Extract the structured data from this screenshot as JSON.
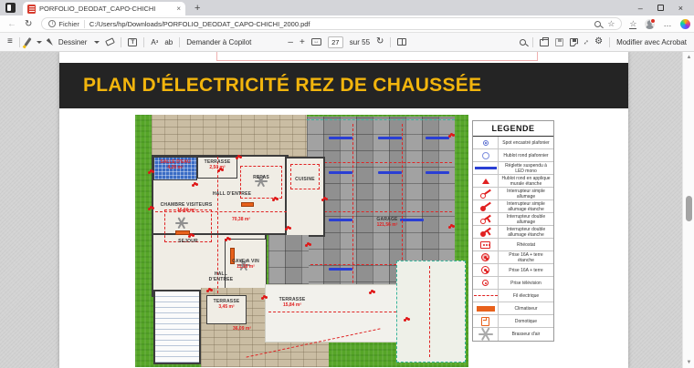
{
  "browser": {
    "tab": {
      "title": "PORFOLIO_DEODAT_CAPO-CHICHI",
      "close_glyph": "×"
    },
    "new_tab_glyph": "+",
    "window": {
      "minimize_glyph": "–",
      "close_glyph": "×"
    },
    "nav": {
      "back_glyph": "←",
      "refresh_glyph": "↻"
    },
    "address": {
      "info_glyph": "i",
      "scheme_label": "Fichier",
      "url": "C:/Users/hp/Downloads/PORFOLIO_DEODAT_CAPO-CHICHI_2000.pdf",
      "favorite_glyph": "☆",
      "collections_glyph": "☆",
      "more_glyph": "…"
    }
  },
  "pdf_toolbar": {
    "toc_glyph": "≡",
    "draw_label": "Dessiner",
    "text_box_glyph": "T",
    "read_aloud_glyph": "Aᵌ",
    "ab_glyph": "ab",
    "copilot_label": "Demander à Copilot",
    "zoom_out_glyph": "–",
    "zoom_in_glyph": "+",
    "fit_glyph": "↔",
    "page_current": "27",
    "page_total_label": "sur 55",
    "rotate_glyph": "↻",
    "expand_glyph": "↕",
    "settings_glyph": "⚙",
    "acrobat_label": "Modifier avec Acrobat"
  },
  "document": {
    "banner_title": "PLAN D'ÉLECTRICITÉ REZ DE CHAUSSÉE",
    "plan": {
      "rooms": [
        {
          "label": "CHAMBRE VISITEURS",
          "area": "16,90 m²"
        },
        {
          "label": "SALLE D'EAU",
          "area": "4,20 m²"
        },
        {
          "label": "TERRASSE",
          "area": "2,50 m²"
        },
        {
          "label": "HALL D'ENTREE",
          "area": ""
        },
        {
          "label": "REPAS",
          "area": ""
        },
        {
          "label": "CUISINE",
          "area": ""
        },
        {
          "label": "SEJOUR",
          "area": "70,38 m²"
        },
        {
          "label": "CAVE A VIN",
          "area": "11,16 m²"
        },
        {
          "label": "TERRASSE",
          "area": "3,45 m²"
        },
        {
          "label": "TERRASSE",
          "area": "15,84 m²"
        },
        {
          "label": "GARAGE",
          "area": "121,56 m²"
        },
        {
          "label": "HALL D'ENTREE",
          "area": ""
        },
        {
          "label": "",
          "area": "36,09 m²"
        }
      ]
    },
    "legend": {
      "title": "LEGENDE",
      "items": [
        {
          "icon": "spot-icon",
          "label": "Spot encastré plafonier"
        },
        {
          "icon": "hublot-plafonnier-icon",
          "label": "Hublot rond plafonnier"
        },
        {
          "icon": "reglette-led-icon",
          "label": "Réglette suspendu à LED mono"
        },
        {
          "icon": "hublot-applique-icon",
          "label": "Hublot rond en applique murale étanche"
        },
        {
          "icon": "interrupteur-simple-icon",
          "label": "Interrupteur simple allumage"
        },
        {
          "icon": "interrupteur-simple-etanche-icon",
          "label": "Interrupteur simple allumage étanche"
        },
        {
          "icon": "interrupteur-double-icon",
          "label": "Interrupteur double allumage"
        },
        {
          "icon": "interrupteur-double-etanche-icon",
          "label": "Interrupteur double allumage étanche"
        },
        {
          "icon": "rheostat-icon",
          "label": "Rhéostat"
        },
        {
          "icon": "prise-terre-etanche-icon",
          "label": "Prise 16A + terre étanche"
        },
        {
          "icon": "prise-terre-icon",
          "label": "Prise 16A + terre"
        },
        {
          "icon": "prise-television-icon",
          "label": "Prise télévision"
        },
        {
          "icon": "fil-electrique-icon",
          "label": "Fil électrique"
        },
        {
          "icon": "climatiseur-icon",
          "label": "Climatiseur"
        },
        {
          "icon": "domotique-icon",
          "label": "Domotique"
        },
        {
          "icon": "brasseur-air-icon",
          "label": "Brasseur d'air"
        }
      ]
    }
  },
  "colors": {
    "accent_yellow": "#f2b50d",
    "banner_black": "#242424",
    "plan_green": "#56a528",
    "symbol_red": "#e02020",
    "led_blue": "#2a3fd4",
    "climatiseur_orange": "#e8611b"
  }
}
